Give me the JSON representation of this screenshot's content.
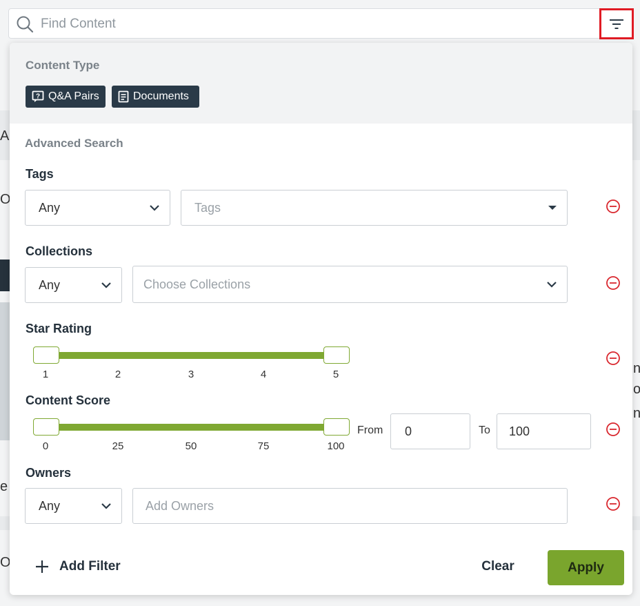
{
  "search": {
    "placeholder": "Find Content",
    "value": ""
  },
  "background": {
    "fragments": [
      "Al",
      "O",
      "e",
      "O",
      "n",
      "o",
      "n."
    ]
  },
  "content_type": {
    "title": "Content Type",
    "chips": [
      {
        "label": "Q&A Pairs",
        "icon": "qa-pairs-icon"
      },
      {
        "label": "Documents",
        "icon": "document-icon"
      }
    ]
  },
  "advanced": {
    "title": "Advanced Search",
    "tags": {
      "label": "Tags",
      "match": "Any",
      "placeholder": "Tags"
    },
    "collections": {
      "label": "Collections",
      "match": "Any",
      "placeholder": "Choose Collections"
    },
    "star_rating": {
      "label": "Star Rating",
      "ticks": [
        "1",
        "2",
        "3",
        "4",
        "5"
      ],
      "min": 1,
      "max": 5,
      "selected": [
        1,
        5
      ]
    },
    "content_score": {
      "label": "Content Score",
      "ticks": [
        "0",
        "25",
        "50",
        "75",
        "100"
      ],
      "min": 0,
      "max": 100,
      "selected": [
        0,
        100
      ],
      "from_label": "From",
      "to_label": "To",
      "from_value": "0",
      "to_value": "100"
    },
    "owners": {
      "label": "Owners",
      "match": "Any",
      "placeholder": "Add Owners"
    }
  },
  "footer": {
    "add_filter": "Add Filter",
    "clear": "Clear",
    "apply": "Apply"
  },
  "colors": {
    "accent_green": "#7aa52d",
    "chip_bg": "#2a3a48",
    "remove_red": "#d9272e",
    "highlight_red": "#e01b24"
  }
}
